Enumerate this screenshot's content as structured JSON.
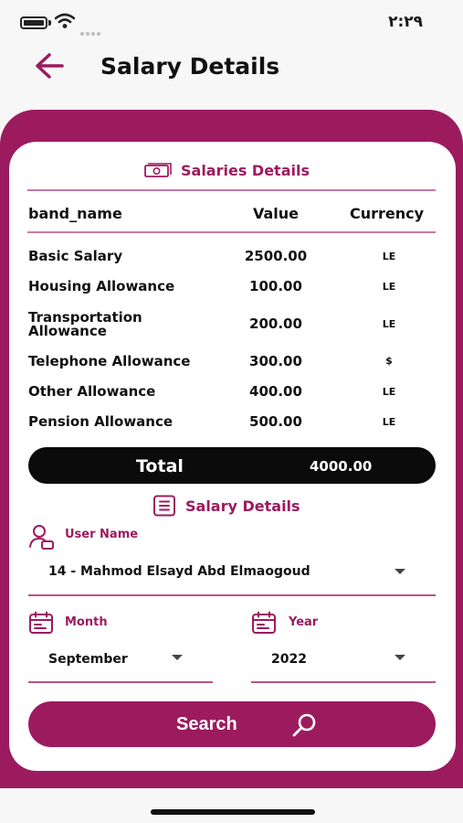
{
  "status_bar": {
    "time": "٢:٢٩"
  },
  "header": {
    "title": "Salary Details"
  },
  "salaries_section": {
    "title": "Salaries Details",
    "columns": [
      "band_name",
      "Value",
      "Currency"
    ],
    "rows": [
      {
        "band_name": "Basic Salary",
        "value": "2500.00",
        "currency": "LE"
      },
      {
        "band_name": "Housing Allowance",
        "value": "100.00",
        "currency": "LE"
      },
      {
        "band_name": "Transportation Allowance",
        "value": "200.00",
        "currency": "LE"
      },
      {
        "band_name": "Telephone Allowance",
        "value": "300.00",
        "currency": "$"
      },
      {
        "band_name": "Other Allowance",
        "value": "400.00",
        "currency": "LE"
      },
      {
        "band_name": "Pension Allowance",
        "value": "500.00",
        "currency": "LE"
      }
    ],
    "total_label": "Total",
    "total_value": "4000.00"
  },
  "filter_section": {
    "title": "Salary Details",
    "user": {
      "label": "User Name",
      "value": "14 - Mahmod Elsayd Abd Elmaogoud"
    },
    "month": {
      "label": "Month",
      "value": "September"
    },
    "year": {
      "label": "Year",
      "value": "2022"
    },
    "search_label": "Search"
  },
  "colors": {
    "accent": "#9c1b5f",
    "total_bar": "#0b0b0b",
    "background": "#f7f7f7"
  }
}
